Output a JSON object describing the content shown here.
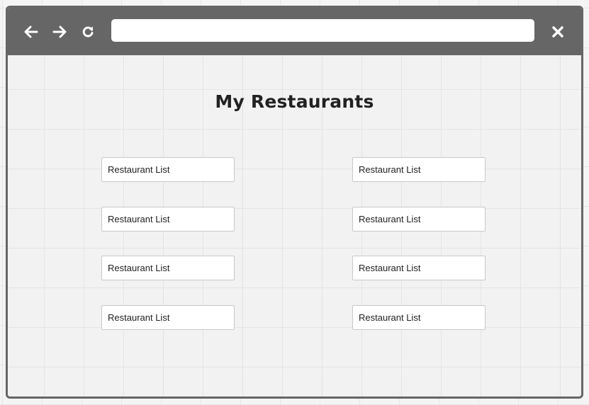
{
  "toolbar": {
    "back_icon": "arrow-left-icon",
    "forward_icon": "arrow-right-icon",
    "reload_icon": "reload-icon",
    "close_icon": "close-icon",
    "address_value": "",
    "address_placeholder": ""
  },
  "page": {
    "title": "My Restaurants"
  },
  "restaurant_lists": {
    "left": [
      {
        "label": "Restaurant List"
      },
      {
        "label": "Restaurant List"
      },
      {
        "label": "Restaurant List"
      },
      {
        "label": "Restaurant List"
      }
    ],
    "right": [
      {
        "label": "Restaurant List"
      },
      {
        "label": "Restaurant List"
      },
      {
        "label": "Restaurant List"
      },
      {
        "label": "Restaurant List"
      }
    ]
  },
  "colors": {
    "toolbar": "#666666",
    "content_bg": "#f2f2f2",
    "title_text": "#222222"
  }
}
